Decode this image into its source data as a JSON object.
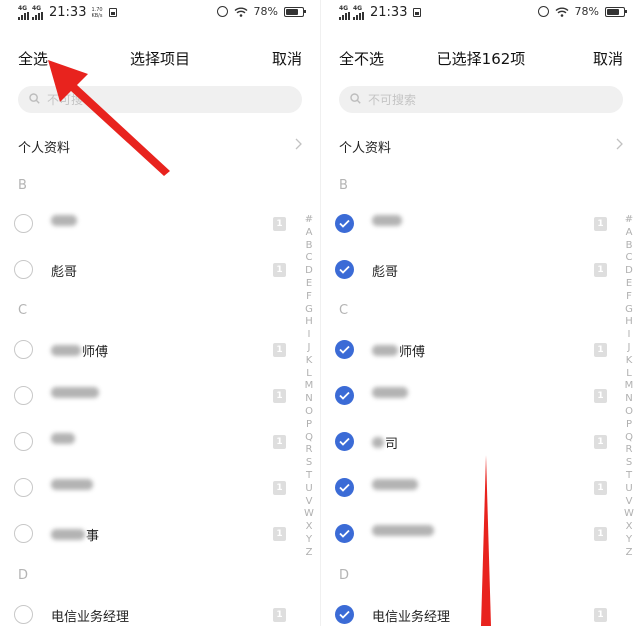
{
  "colors": {
    "accent": "#3b6bd6",
    "annotation_arrow": "#e8231e",
    "section_text": "#b4b4b4"
  },
  "status": {
    "network_label": "4G",
    "time": "21:33",
    "speed_value": "1.70",
    "speed_unit": "KB/s",
    "battery": "78%"
  },
  "index_letters": [
    "#",
    "A",
    "B",
    "C",
    "D",
    "E",
    "F",
    "G",
    "H",
    "I",
    "J",
    "K",
    "L",
    "M",
    "N",
    "O",
    "P",
    "Q",
    "R",
    "S",
    "T",
    "U",
    "V",
    "W",
    "X",
    "Y",
    "Z"
  ],
  "screens": [
    {
      "header": {
        "left": "全选",
        "title": "选择项目",
        "right": "取消"
      },
      "search_placeholder": "不可搜",
      "profile_label": "个人资料",
      "sections": [
        "B",
        "C",
        "D"
      ],
      "contacts": [
        {
          "visible_text": "",
          "checked": false,
          "badge": "1"
        },
        {
          "visible_text": "彪哥",
          "checked": false,
          "badge": "1"
        },
        {
          "visible_text": "师傅",
          "checked": false,
          "badge": "1"
        },
        {
          "visible_text": "",
          "checked": false,
          "badge": "1"
        },
        {
          "visible_text": "",
          "checked": false,
          "badge": "1"
        },
        {
          "visible_text": "",
          "checked": false,
          "badge": "1"
        },
        {
          "visible_text": "事",
          "checked": false,
          "badge": "1"
        },
        {
          "visible_text": "电信业务经理",
          "checked": false,
          "badge": "1"
        }
      ]
    },
    {
      "header": {
        "left": "全不选",
        "title": "已选择162项",
        "right": "取消"
      },
      "search_placeholder": "不可搜索",
      "profile_label": "个人资料",
      "sections": [
        "B",
        "C",
        "D"
      ],
      "contacts": [
        {
          "visible_text": "",
          "checked": true,
          "badge": "1"
        },
        {
          "visible_text": "彪哥",
          "checked": true,
          "badge": "1"
        },
        {
          "visible_text": "师傅",
          "checked": true,
          "badge": "1"
        },
        {
          "visible_text": "",
          "checked": true,
          "badge": "1"
        },
        {
          "visible_text": "司",
          "checked": true,
          "badge": "1"
        },
        {
          "visible_text": "",
          "checked": true,
          "badge": "1"
        },
        {
          "visible_text": "",
          "checked": true,
          "badge": "1"
        },
        {
          "visible_text": "电信业务经理",
          "checked": true,
          "badge": "1"
        }
      ]
    }
  ]
}
